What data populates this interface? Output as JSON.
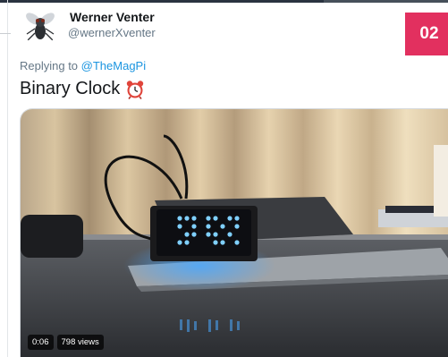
{
  "user": {
    "name": "Werner Venter",
    "handle": "@wernerXventer"
  },
  "badge": "02",
  "reply": {
    "prefix": "Replying to",
    "mention": "@TheMagPi"
  },
  "tweet": {
    "text": "Binary Clock",
    "emoji_icon": "alarm-clock-icon"
  },
  "video": {
    "timestamp": "0:06",
    "views": "798 views"
  },
  "colors": {
    "badge": "#e2305f",
    "link": "#1b95e0",
    "muted": "#657786"
  }
}
